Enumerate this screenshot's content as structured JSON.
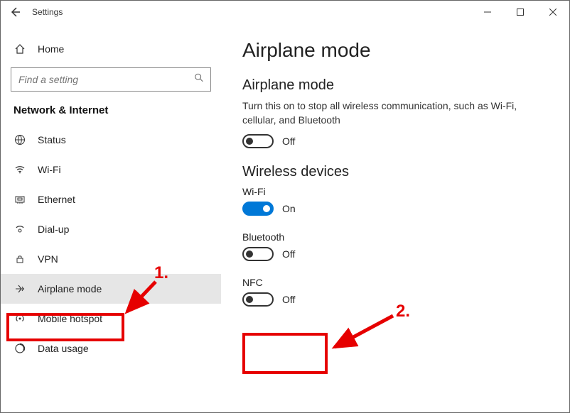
{
  "window": {
    "title": "Settings"
  },
  "home": {
    "label": "Home"
  },
  "search": {
    "placeholder": "Find a setting"
  },
  "category": {
    "title": "Network & Internet"
  },
  "nav": {
    "items": [
      {
        "label": "Status"
      },
      {
        "label": "Wi-Fi"
      },
      {
        "label": "Ethernet"
      },
      {
        "label": "Dial-up"
      },
      {
        "label": "VPN"
      },
      {
        "label": "Airplane mode"
      },
      {
        "label": "Mobile hotspot"
      },
      {
        "label": "Data usage"
      }
    ]
  },
  "content": {
    "title": "Airplane mode",
    "section1": {
      "title": "Airplane mode",
      "desc": "Turn this on to stop all wireless communication, such as Wi-Fi, cellular, and Bluetooth",
      "state": "Off"
    },
    "section2": {
      "title": "Wireless devices",
      "wifi": {
        "label": "Wi-Fi",
        "state": "On"
      },
      "bluetooth": {
        "label": "Bluetooth",
        "state": "Off"
      },
      "nfc": {
        "label": "NFC",
        "state": "Off"
      }
    }
  },
  "annotations": {
    "a1": "1.",
    "a2": "2."
  }
}
